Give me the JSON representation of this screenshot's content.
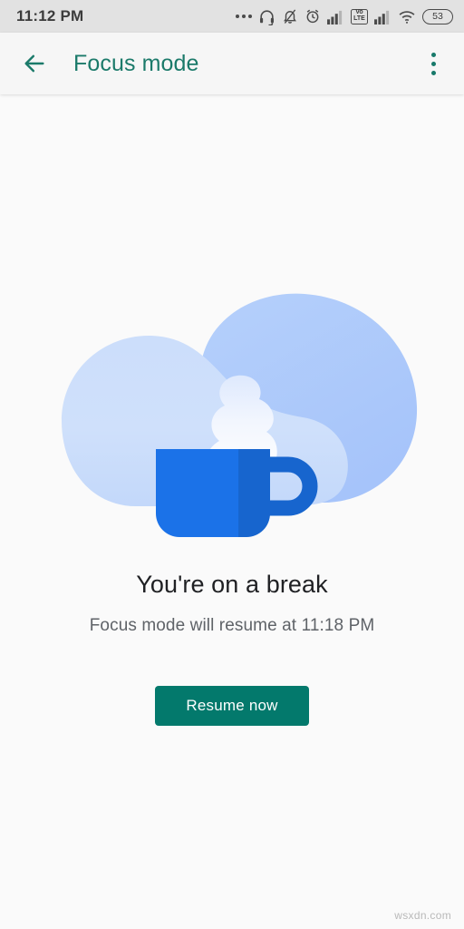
{
  "status_bar": {
    "time": "11:12 PM",
    "battery_level": "53",
    "volte_top": "Vo",
    "volte_bottom": "LTE",
    "icons": [
      "more-dots-icon",
      "headset-icon",
      "bell-muted-icon",
      "alarm-clock-icon",
      "signal-bars-icon",
      "volte-icon",
      "signal-bars-2-icon",
      "wifi-icon",
      "battery-icon"
    ]
  },
  "app_bar": {
    "back_label": "back-arrow-icon",
    "title": "Focus mode",
    "overflow_label": "overflow-menu-icon",
    "accent_color": "#1b7a6a"
  },
  "main": {
    "illustration": "coffee-mug-break-illustration",
    "headline": "You're on a break",
    "subtext": "Focus mode will resume at 11:18 PM",
    "resume_button": "Resume now",
    "button_color": "#03796c"
  },
  "watermark": "wsxdn.com"
}
